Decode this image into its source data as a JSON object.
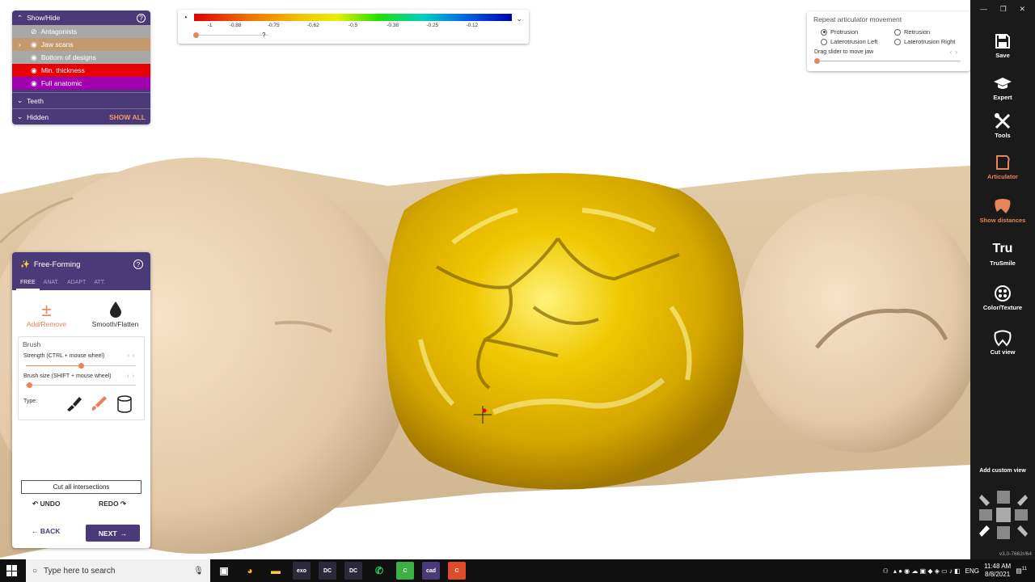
{
  "colors": {
    "panel_purple": "#4a3a78",
    "accent_orange": "#e8845a",
    "crown_gold": "#e6b800",
    "teeth_beige": "#e6ceb0",
    "toolbar_bg": "#1a1a1a"
  },
  "show_hide": {
    "title": "Show/Hide",
    "items": [
      {
        "label": "Antagonists",
        "color": "#a8a8a8",
        "icon": "eye-off-icon"
      },
      {
        "label": "Jaw scans",
        "color": "#c49a6c",
        "icon": "eye-icon"
      },
      {
        "label": "Bottom of designs",
        "color": "#a8a8a8",
        "icon": "eye-icon"
      },
      {
        "label": "Min. thickness",
        "color": "#e60000",
        "icon": "eye-icon"
      },
      {
        "label": "Full anatomic",
        "color": "#a000b0",
        "icon": "eye-icon"
      }
    ],
    "teeth_label": "Teeth",
    "hidden_label": "Hidden",
    "show_all": "SHOW ALL"
  },
  "scale": {
    "ticks": [
      "-1",
      "-0.88",
      "-0.75",
      "-0.62",
      "-0.5",
      "-0.38",
      "-0.25",
      "-0.12"
    ],
    "unknown": "?"
  },
  "articulator": {
    "title": "Repeat articulator movement",
    "options": [
      {
        "label": "Protrusion",
        "selected": true
      },
      {
        "label": "Retrusion",
        "selected": false
      },
      {
        "label": "Laterotrusion Left",
        "selected": false
      },
      {
        "label": "Laterotrusion Right",
        "selected": false
      }
    ],
    "hint": "Drag slider to move jaw"
  },
  "freeform": {
    "title": "Free-Forming",
    "tabs": [
      "FREE",
      "ANAT.",
      "ADAPT",
      "ATT."
    ],
    "tool_add": "Add/Remove",
    "tool_smooth": "Smooth/Flatten",
    "brush_title": "Brush",
    "strength_label": "Strength (CTRL + mouse wheel)",
    "strength_value": 0.5,
    "size_label": "Brush size (SHIFT + mouse wheel)",
    "size_value": 0.03,
    "type_label": "Type:",
    "cut_label": "Cut all intersections",
    "undo": "UNDO",
    "redo": "REDO",
    "back": "BACK",
    "next": "NEXT"
  },
  "toolbar": {
    "items": [
      {
        "label": "Save",
        "icon": "save-icon",
        "active": false
      },
      {
        "label": "Expert",
        "icon": "graduation-cap-icon",
        "active": false
      },
      {
        "label": "Tools",
        "icon": "tools-icon",
        "active": false
      },
      {
        "label": "Articulator",
        "icon": "articulator-icon",
        "active": true
      },
      {
        "label": "Show distances",
        "icon": "show-distances-icon",
        "active": true
      },
      {
        "label": "TruSmile",
        "icon": "trusmile-icon",
        "active": false
      },
      {
        "label": "Color/Texture",
        "icon": "color-texture-icon",
        "active": false
      },
      {
        "label": "Cut view",
        "icon": "cut-view-icon",
        "active": false
      }
    ],
    "trusmile_glyph": "Tru",
    "add_custom_view": "Add custom view",
    "version": "v3.0-7662r/64"
  },
  "taskbar": {
    "search_placeholder": "Type here to search",
    "apps": [
      {
        "label": "",
        "color": "#101010",
        "icon": "task-view-icon"
      },
      {
        "label": "",
        "color": "#101010",
        "icon": "chrome-icon"
      },
      {
        "label": "",
        "color": "#101010",
        "icon": "folder-icon"
      },
      {
        "label": "exo",
        "color": "#2a2a3a",
        "icon": "exocad-icon"
      },
      {
        "label": "DC",
        "color": "#2a2a3a",
        "icon": "dc-icon"
      },
      {
        "label": "DC",
        "color": "#2a2a3a",
        "icon": "dc-icon"
      },
      {
        "label": "",
        "color": "#101010",
        "icon": "whatsapp-icon"
      },
      {
        "label": "C",
        "color": "#3cb043",
        "icon": "camtasia-icon"
      },
      {
        "label": "cad",
        "color": "#4a3a78",
        "icon": "cad-icon"
      },
      {
        "label": "C",
        "color": "#e04a2a",
        "icon": "recorder-icon"
      }
    ],
    "lang": "ENG",
    "time": "11:48 AM",
    "date": "8/8/2021",
    "notifications": "11"
  }
}
